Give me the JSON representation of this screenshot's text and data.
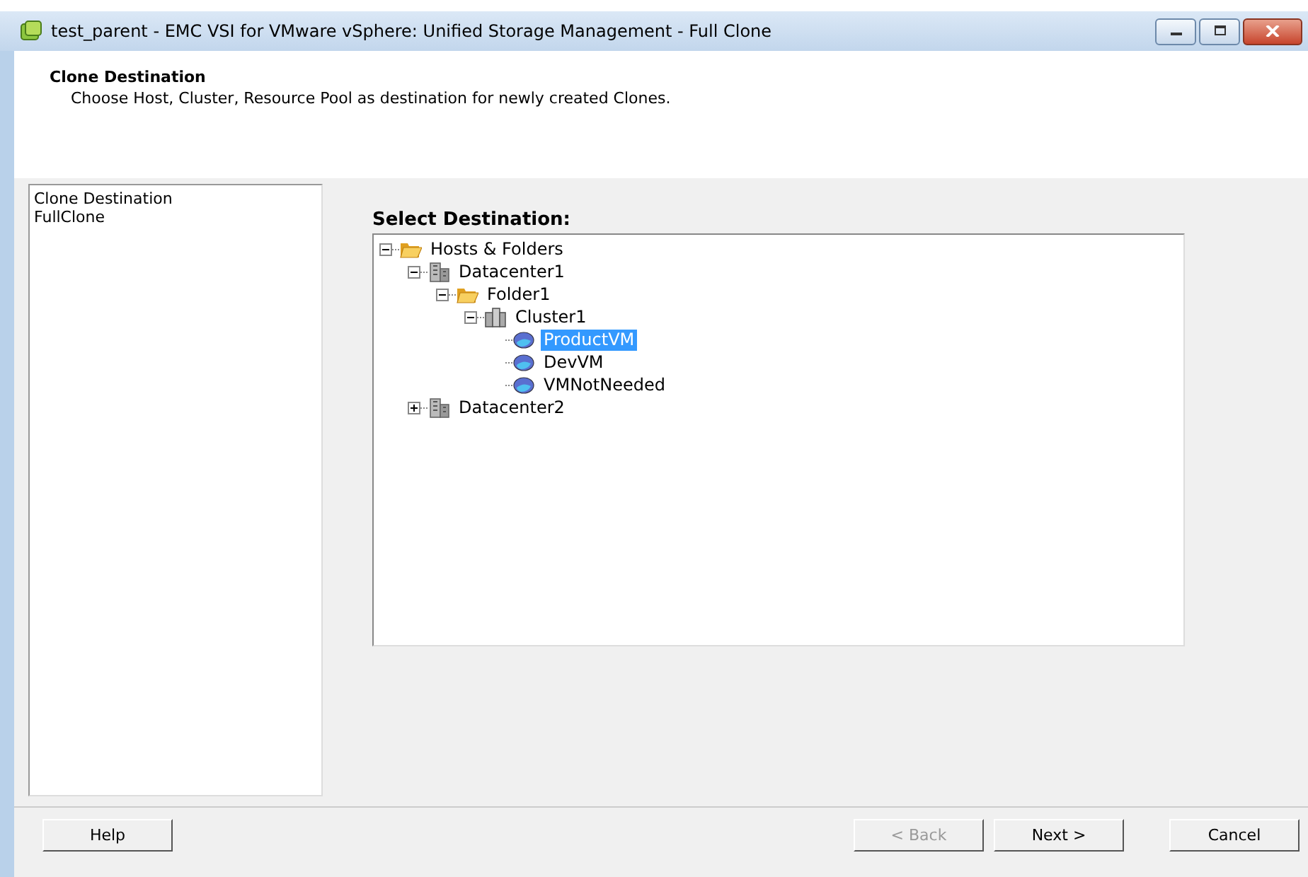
{
  "window": {
    "title": "test_parent - EMC VSI for VMware vSphere: Unified Storage Management - Full Clone"
  },
  "header": {
    "title": "Clone Destination",
    "description": "Choose Host, Cluster, Resource Pool as destination for newly created Clones."
  },
  "steps": [
    "Clone Destination",
    "FullClone"
  ],
  "destination": {
    "label": "Select Destination:",
    "tree": [
      {
        "kind": "folder",
        "label": "Hosts & Folders",
        "expanded": true,
        "selected": false,
        "children": [
          {
            "kind": "datacenter",
            "label": "Datacenter1",
            "expanded": true,
            "selected": false,
            "children": [
              {
                "kind": "folder",
                "label": "Folder1",
                "expanded": true,
                "selected": false,
                "children": [
                  {
                    "kind": "cluster",
                    "label": "Cluster1",
                    "expanded": true,
                    "selected": false,
                    "children": [
                      {
                        "kind": "vm",
                        "label": "ProductVM",
                        "selected": true
                      },
                      {
                        "kind": "vm",
                        "label": "DevVM",
                        "selected": false
                      },
                      {
                        "kind": "vm",
                        "label": "VMNotNeeded",
                        "selected": false
                      }
                    ]
                  }
                ]
              }
            ]
          },
          {
            "kind": "datacenter",
            "label": "Datacenter2",
            "expanded": false,
            "selected": false
          }
        ]
      }
    ]
  },
  "buttons": [
    {
      "kind": "help",
      "label": "Help",
      "disabled": false
    },
    {
      "kind": "back",
      "label": "< Back",
      "disabled": true
    },
    {
      "kind": "next",
      "label": "Next >",
      "disabled": false
    },
    {
      "kind": "cancel",
      "label": "Cancel",
      "disabled": false
    }
  ]
}
